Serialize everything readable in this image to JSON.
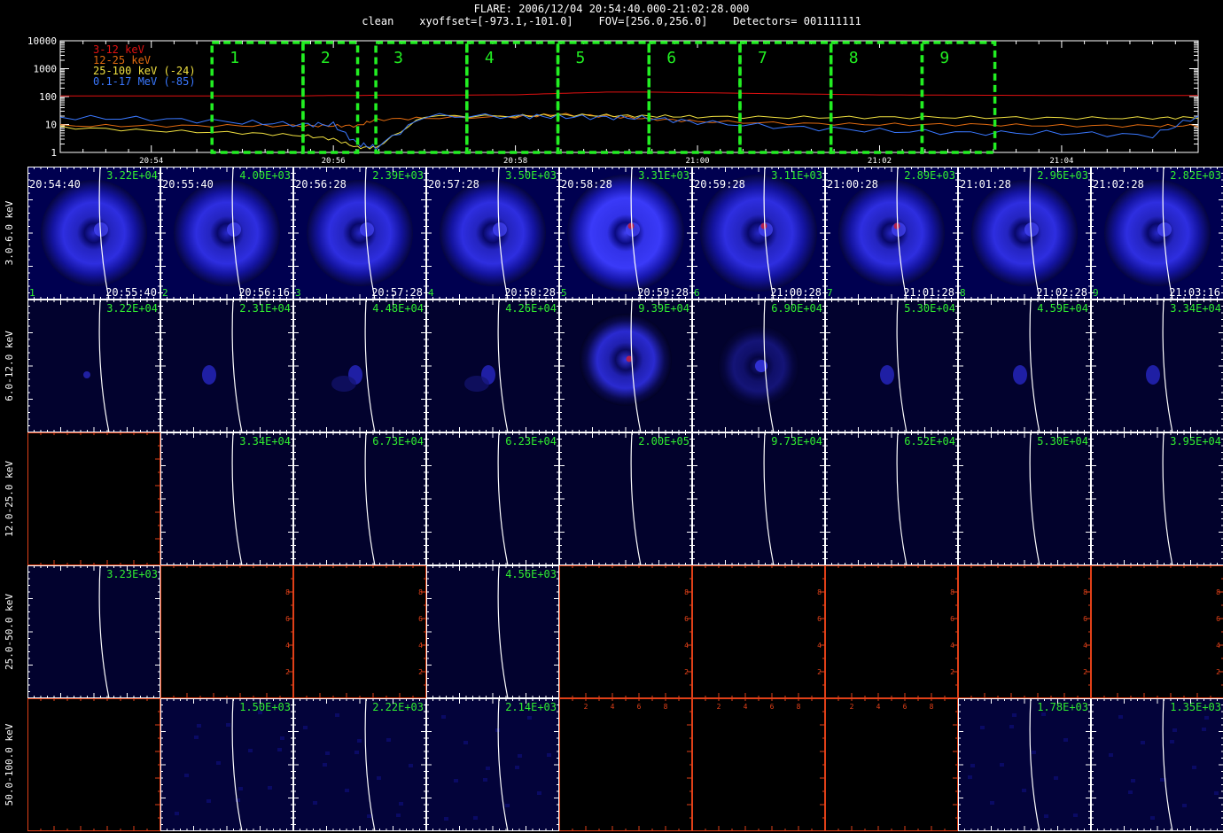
{
  "header": {
    "title": "FLARE: 2006/12/04 20:54:40.000-21:02:28.000",
    "subtitle": "clean    xyoffset=[-973.1,-101.0]    FOV=[256.0,256.0]    Detectors= 001111111"
  },
  "lightcurve": {
    "y_ticks": [
      "10000",
      "1000",
      "100",
      "10",
      "1"
    ],
    "x_ticks": [
      "20:54",
      "20:56",
      "20:58",
      "21:00",
      "21:02",
      "21:04"
    ],
    "legend": [
      {
        "label": "3-12 keV",
        "color": "#e01010"
      },
      {
        "label": "12-25 keV",
        "color": "#e06a10"
      },
      {
        "label": "25-100 keV (-24)",
        "color": "#f0e040"
      },
      {
        "label": "0.1-17 MeV (-85)",
        "color": "#3a78ff"
      }
    ],
    "intervals": [
      "1",
      "2",
      "3",
      "4",
      "5",
      "6",
      "7",
      "8",
      "9"
    ],
    "interval_color": "#22ee22"
  },
  "bands": [
    "3.0-6.0 keV",
    "6.0-12.0 keV",
    "12.0-25.0 keV",
    "25.0-50.0 keV",
    "50.0-100.0 keV"
  ],
  "start_times": [
    "20:54:40",
    "20:55:40",
    "20:56:28",
    "20:57:28",
    "20:58:28",
    "20:59:28",
    "21:00:28",
    "21:01:28",
    "21:02:28"
  ],
  "end_times": [
    "20:55:40",
    "20:56:16",
    "20:57:28",
    "20:58:28",
    "20:59:28",
    "21:00:28",
    "21:01:28",
    "21:02:28",
    "21:03:16"
  ],
  "panels": [
    [
      "3.22E+04",
      "4.00E+03",
      "2.39E+03",
      "3.50E+03",
      "3.31E+03",
      "3.11E+03",
      "2.89E+03",
      "2.96E+03",
      "2.82E+03"
    ],
    [
      "3.22E+04",
      "2.31E+04",
      "4.48E+04",
      "4.26E+04",
      "9.39E+04",
      "6.90E+04",
      "5.30E+04",
      "4.59E+04",
      "3.34E+04"
    ],
    [
      "",
      "3.34E+04",
      "6.73E+04",
      "6.23E+04",
      "2.00E+05",
      "9.73E+04",
      "6.52E+04",
      "5.30E+04",
      "3.95E+04"
    ],
    [
      "3.23E+03",
      "",
      "",
      "4.56E+03",
      "",
      "",
      "",
      "",
      ""
    ],
    [
      "",
      "1.50E+03",
      "2.22E+03",
      "2.14E+03",
      "",
      "",
      "",
      "1.78E+03",
      "1.35E+03"
    ]
  ],
  "empty_axis_ticks": [
    "2",
    "4",
    "6",
    "8"
  ],
  "chart_data": {
    "type": "line",
    "title": "FLARE: 2006/12/04 20:54:40.000-21:02:28.000",
    "xlabel": "",
    "ylabel": "",
    "y_scale": "log",
    "ylim": [
      1,
      10000
    ],
    "x_ticks": [
      "20:54",
      "20:56",
      "20:58",
      "21:00",
      "21:02",
      "21:04"
    ],
    "x": [
      "20:53:00",
      "20:54:00",
      "20:55:00",
      "20:55:40",
      "20:56:00",
      "20:56:16",
      "20:56:28",
      "20:57:00",
      "20:58:00",
      "20:58:28",
      "20:59:00",
      "20:59:28",
      "21:00:00",
      "21:01:00",
      "21:02:00",
      "21:03:00",
      "21:04:00",
      "21:05:00",
      "21:05:30"
    ],
    "series": [
      {
        "name": "3-12 keV",
        "color": "#e01010",
        "values": [
          105,
          105,
          105,
          106,
          110,
          110,
          112,
          112,
          116,
          130,
          145,
          145,
          138,
          125,
          115,
          112,
          110,
          110,
          110
        ]
      },
      {
        "name": "12-25 keV",
        "color": "#e06a10",
        "values": [
          9,
          9,
          9,
          9,
          9,
          9,
          15,
          17,
          19,
          23,
          20,
          16,
          13,
          11,
          10,
          10,
          9,
          9,
          9
        ]
      },
      {
        "name": "25-100 keV (-24)",
        "color": "#f0e040",
        "values": [
          8,
          6,
          5,
          4,
          3,
          1.5,
          1.5,
          20,
          20,
          22,
          21,
          20,
          19,
          18,
          18,
          18,
          17,
          17,
          18
        ]
      },
      {
        "name": "0.1-17 MeV (-85)",
        "color": "#3a78ff",
        "values": [
          18,
          16,
          12,
          10,
          10,
          2,
          1.5,
          20,
          20,
          19,
          18,
          17,
          12,
          8,
          6,
          5,
          5,
          4,
          20
        ]
      }
    ],
    "intervals": [
      {
        "label": "1",
        "start": "20:54:40",
        "end": "20:55:40"
      },
      {
        "label": "2",
        "start": "20:55:40",
        "end": "20:56:16"
      },
      {
        "label": "3",
        "start": "20:56:28",
        "end": "20:57:28"
      },
      {
        "label": "4",
        "start": "20:57:28",
        "end": "20:58:28"
      },
      {
        "label": "5",
        "start": "20:58:28",
        "end": "20:59:28"
      },
      {
        "label": "6",
        "start": "20:59:28",
        "end": "21:00:28"
      },
      {
        "label": "7",
        "start": "21:00:28",
        "end": "21:01:28"
      },
      {
        "label": "8",
        "start": "21:01:28",
        "end": "21:02:28"
      },
      {
        "label": "9",
        "start": "21:02:28",
        "end": "21:03:16"
      }
    ]
  }
}
